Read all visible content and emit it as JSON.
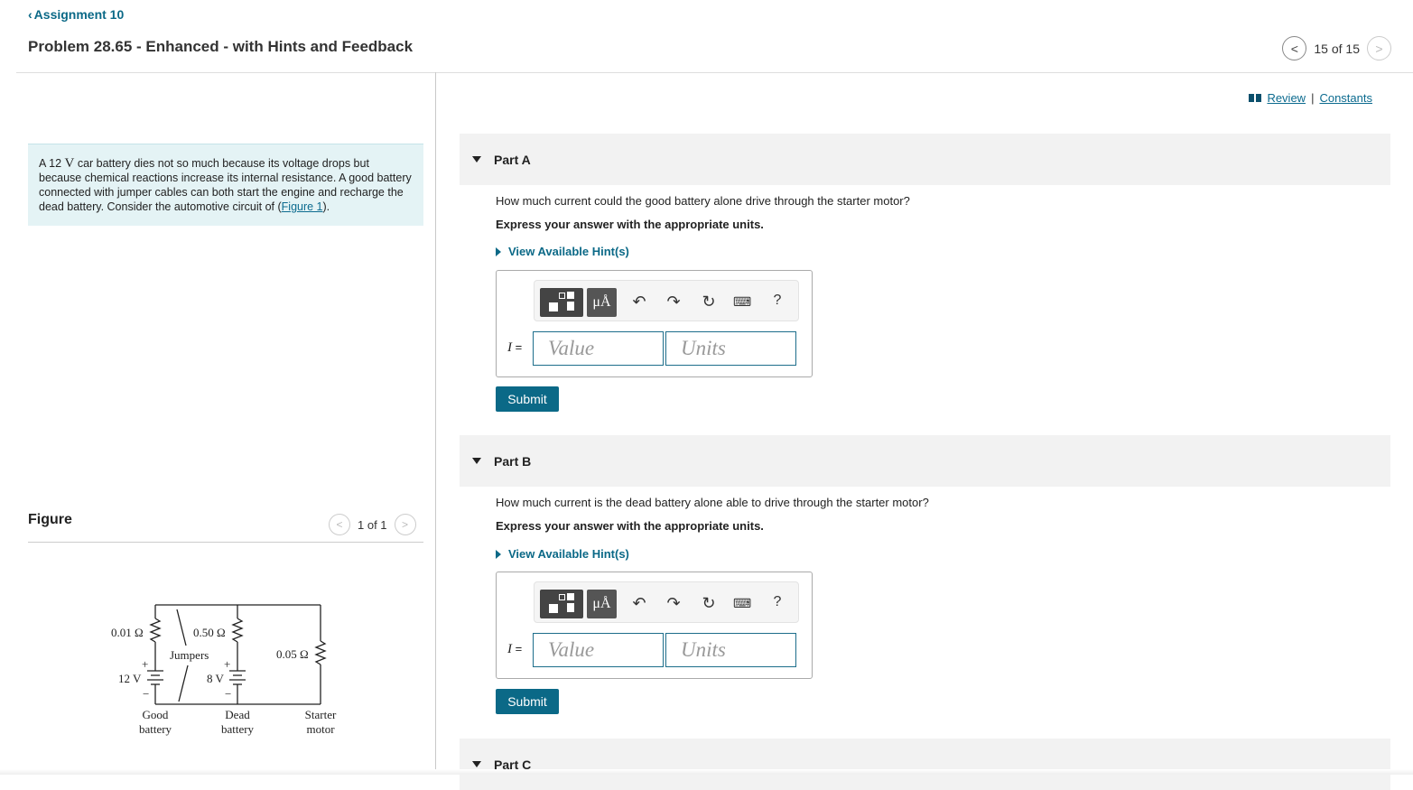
{
  "header": {
    "back_label": "Assignment 10",
    "title": "Problem 28.65 - Enhanced - with Hints and Feedback",
    "pager_text": "15 of 15"
  },
  "intro": {
    "pre": "A 12 ",
    "unit": "V",
    "text": " car battery dies not so much because its voltage drops but because chemical reactions increase its internal resistance. A good battery connected with jumper cables can both start the engine and recharge the dead battery. Consider the automotive circuit of (",
    "link": "Figure 1",
    "post": ")."
  },
  "figure": {
    "label": "Figure",
    "pager_text": "1 of 1",
    "circuit": {
      "r_good": "0.01 Ω",
      "r_dead": "0.50 Ω",
      "r_starter": "0.05 Ω",
      "v_good": "12 V",
      "v_dead": "8 V",
      "jumpers": "Jumpers",
      "plus": "+",
      "minus": "−",
      "label_good_1": "Good",
      "label_good_2": "battery",
      "label_dead_1": "Dead",
      "label_dead_2": "battery",
      "label_starter_1": "Starter",
      "label_starter_2": "motor"
    }
  },
  "links": {
    "review": "Review",
    "separator": "|",
    "constants": "Constants"
  },
  "toolbar": {
    "mu_label": "μÅ",
    "help_label": "?"
  },
  "parts": [
    {
      "label": "Part A",
      "question": "How much current could the good battery alone drive through the starter motor?",
      "express": "Express your answer with the appropriate units.",
      "hint": "View Available Hint(s)",
      "var": "I",
      "eq": " =",
      "value_placeholder": "Value",
      "units_placeholder": "Units",
      "submit": "Submit"
    },
    {
      "label": "Part B",
      "question": "How much current is the dead battery alone able to drive through the starter motor?",
      "express": "Express your answer with the appropriate units.",
      "hint": "View Available Hint(s)",
      "var": "I",
      "eq": " =",
      "value_placeholder": "Value",
      "units_placeholder": "Units",
      "submit": "Submit"
    },
    {
      "label": "Part C"
    }
  ]
}
